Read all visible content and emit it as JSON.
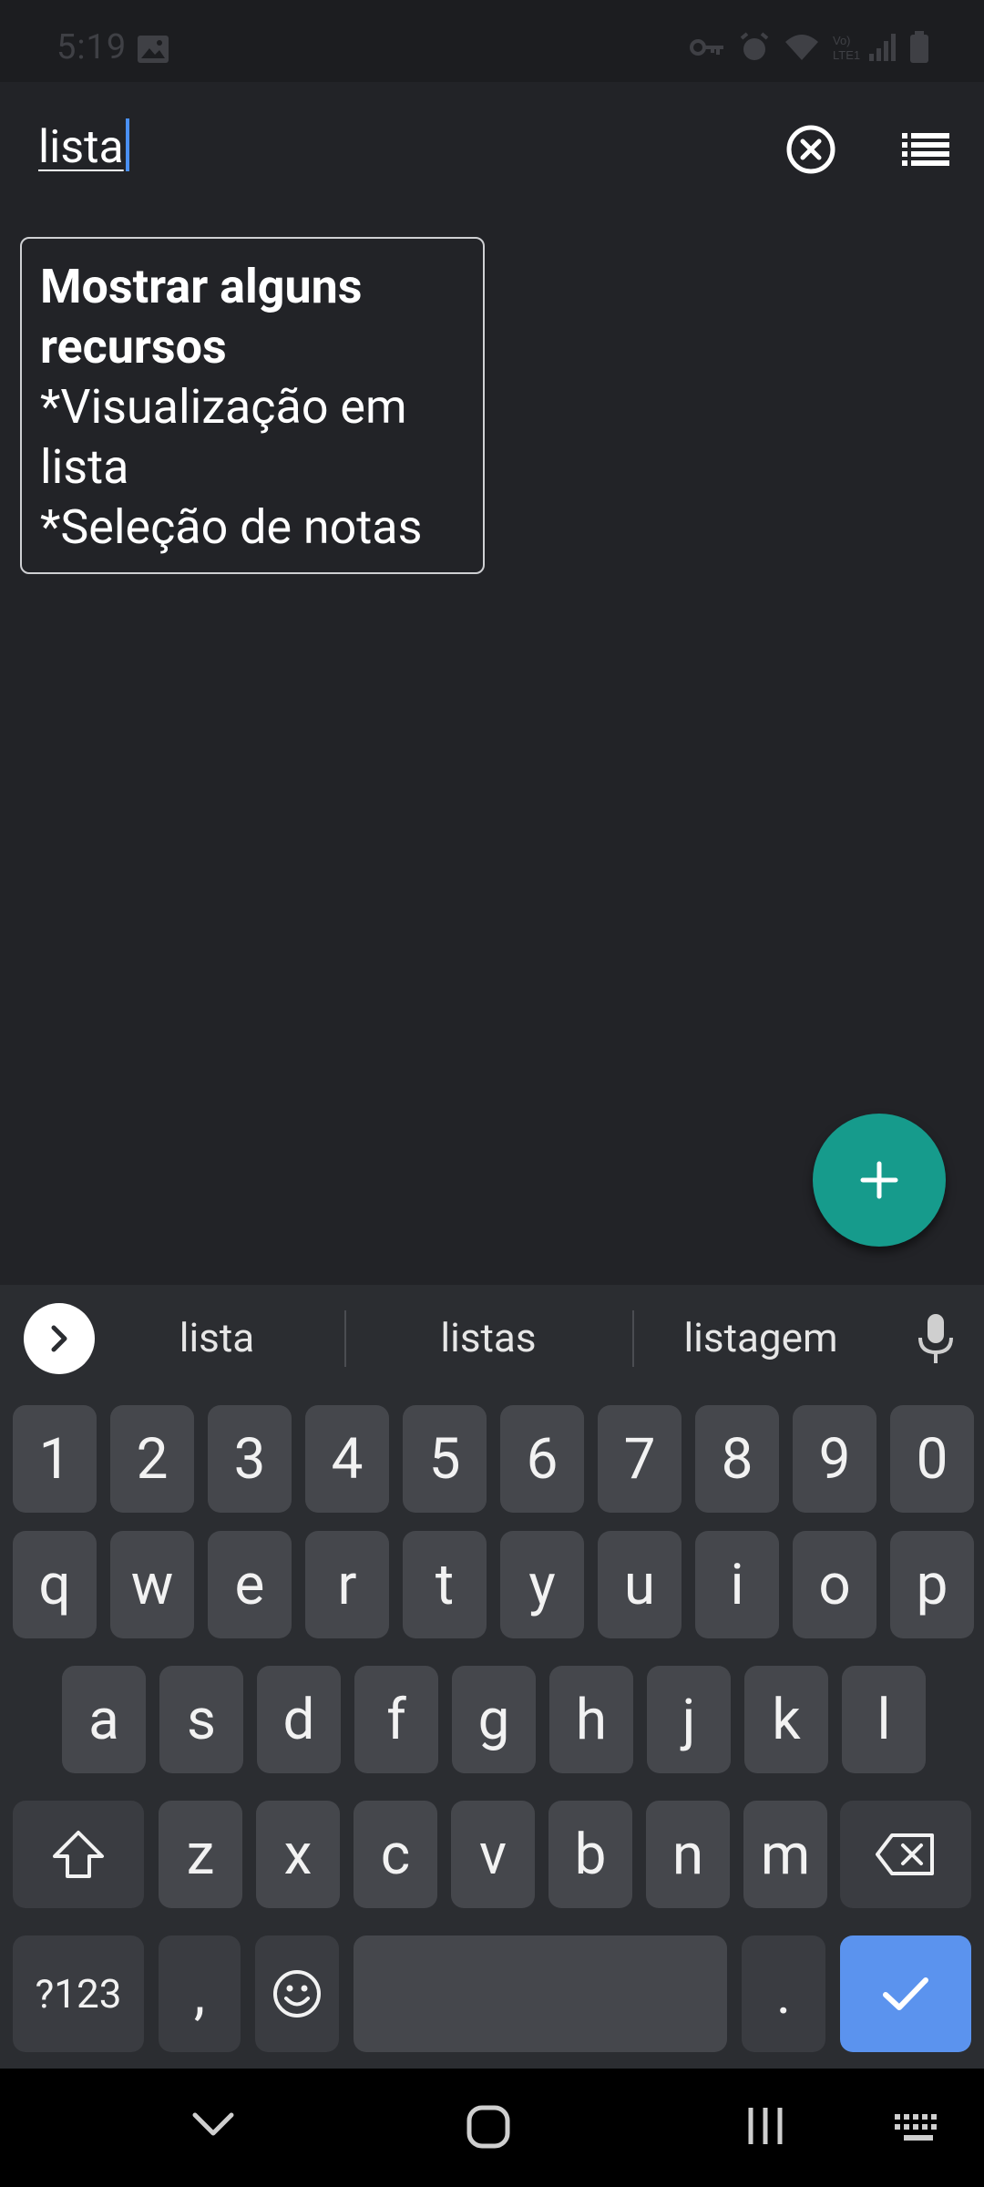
{
  "status_bar": {
    "time": "5:19"
  },
  "search": {
    "query": "lista"
  },
  "note": {
    "title": "Mostrar alguns recursos",
    "body": "*Visualização em lista\n*Seleção de notas"
  },
  "keyboard": {
    "suggestions": [
      "lista",
      "listas",
      "listagem"
    ],
    "row_numbers": [
      "1",
      "2",
      "3",
      "4",
      "5",
      "6",
      "7",
      "8",
      "9",
      "0"
    ],
    "row1": [
      "q",
      "w",
      "e",
      "r",
      "t",
      "y",
      "u",
      "i",
      "o",
      "p"
    ],
    "row2": [
      "a",
      "s",
      "d",
      "f",
      "g",
      "h",
      "j",
      "k",
      "l"
    ],
    "row3": [
      "z",
      "x",
      "c",
      "v",
      "b",
      "n",
      "m"
    ],
    "symbols_label": "?123",
    "comma": ",",
    "period": "."
  },
  "colors": {
    "background": "#222327",
    "fab": "#169b8c",
    "enter_key": "#5b93ee",
    "cursor": "#4a90f5"
  },
  "icons": [
    "clear-search-icon",
    "list-view-icon",
    "add-icon",
    "mic-icon",
    "shift-icon",
    "backspace-icon",
    "emoji-icon",
    "check-icon"
  ]
}
